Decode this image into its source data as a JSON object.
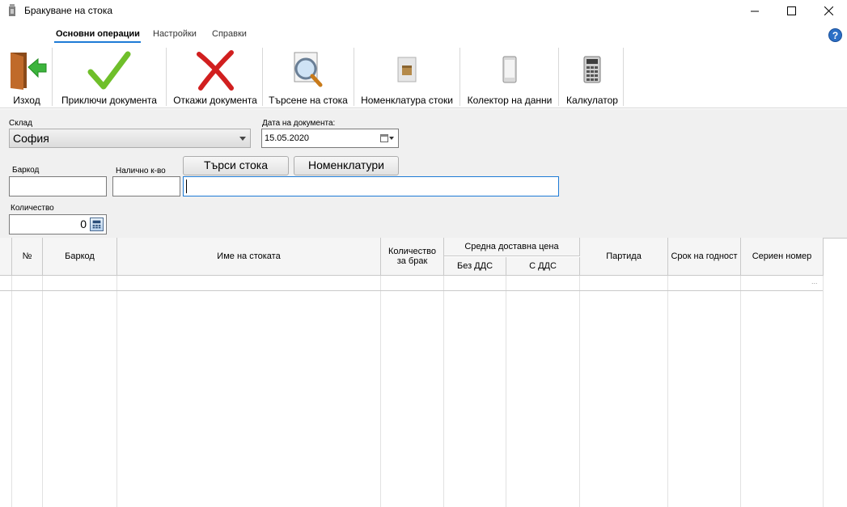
{
  "window": {
    "title": "Бракуване на стока",
    "controls": [
      "minimize",
      "maximize",
      "close"
    ]
  },
  "tabs": [
    {
      "label": "Основни операции",
      "active": true
    },
    {
      "label": "Настройки",
      "active": false
    },
    {
      "label": "Справки",
      "active": false
    }
  ],
  "help": {
    "label": "?"
  },
  "ribbon": {
    "exit": "Изход",
    "finish": "Приключи документа",
    "cancel": "Откажи документа",
    "search": "Търсене на стока",
    "nomenclature": "Номенклатура стоки",
    "collector": "Колектор на данни",
    "calculator": "Калкулатор"
  },
  "form": {
    "warehouse_label": "Склад",
    "warehouse_value": "София",
    "date_label": "Дата на документа:",
    "date_value": "15.05.2020",
    "barcode_label": "Баркод",
    "available_label": "Налично к-во",
    "search_button": "Търси стока",
    "nomenclature_button": "Номенклатури",
    "quantity_label": "Количество",
    "quantity_value": "0"
  },
  "grid": {
    "columns": {
      "num": "№",
      "barcode": "Баркод",
      "name": "Име на стоката",
      "qty": "Количество за брак",
      "avg_price": "Средна доставна цена",
      "no_vat": "Без ДДС",
      "with_vat": "С ДДС",
      "batch": "Партида",
      "expiry": "Срок на годност",
      "serial": "Сериен номер"
    },
    "new_row_marker": "..."
  },
  "colors": {
    "accent": "#1e7bd6",
    "form_bg": "#f0f0f0",
    "check_green": "#6fbf2a",
    "cancel_red": "#d11f1f"
  }
}
